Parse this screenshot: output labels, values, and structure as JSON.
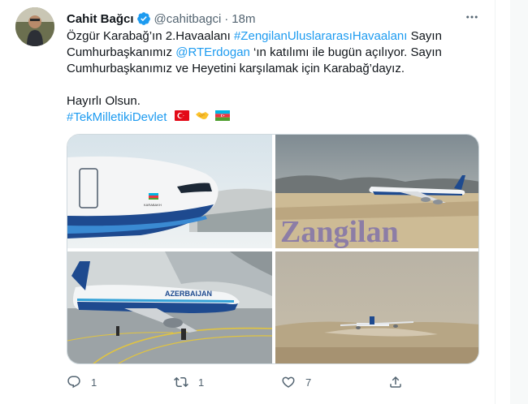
{
  "tweet": {
    "display_name": "Cahit Bağcı",
    "handle": "@cahitbagci",
    "separator": "·",
    "time": "18m",
    "text": {
      "line1_a": "Özgür Karabağ’ın 2.Havaalanı ",
      "hashtag1": "#ZengilanUluslararasıHavaalanı",
      "line1_b": " Sayın",
      "line2_a": "Cumhurbaşkanımız ",
      "mention": "@RTErdogan",
      "line2_b": " ‘ın katılımı ile bugün açılıyor. Sayın",
      "line3": "Cumhurbaşkanımız ve Heyetini karşılamak için Karabağ’dayız.",
      "line4": "Hayırlı Olsun.",
      "hashtag2": "#TekMilletikiDevlet"
    },
    "flags": [
      "turkey-flag",
      "handshake-emoji",
      "azerbaijan-flag"
    ],
    "media": {
      "image1_text": "KARABAKH",
      "image2_text": "Zangilan",
      "image3_text": "AZERBAIJAN"
    },
    "actions": {
      "reply_count": "1",
      "retweet_count": "1",
      "like_count": "7",
      "share_label": ""
    }
  },
  "colors": {
    "link": "#1d9bf0",
    "secondary_text": "#536471",
    "verified": "#1d9bf0"
  }
}
